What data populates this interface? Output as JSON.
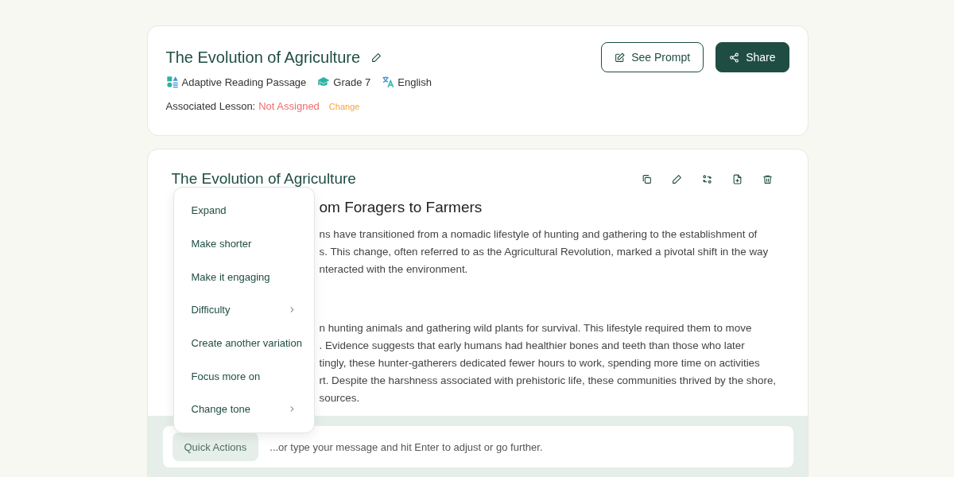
{
  "header": {
    "title": "The Evolution of Agriculture",
    "tags": [
      {
        "kind": "type",
        "label": "Adaptive Reading Passage"
      },
      {
        "kind": "grade",
        "label": "Grade 7"
      },
      {
        "kind": "language",
        "label": "English"
      }
    ],
    "lesson": {
      "label": "Associated Lesson:",
      "value": "Not Assigned",
      "action": "Change"
    },
    "buttons": [
      {
        "kind": "outline",
        "label": "See Prompt"
      },
      {
        "kind": "primary",
        "label": "Share"
      }
    ]
  },
  "document": {
    "title": "The Evolution of Agriculture",
    "blocks": [
      {
        "kind": "heading",
        "lines": [
          "om Foragers to Farmers"
        ]
      },
      {
        "kind": "paragraph",
        "lines": [
          "ns have transitioned from a nomadic lifestyle of hunting and gathering to the establishment of",
          "s. This change, often referred to as the Agricultural Revolution, marked a pivotal shift in the way",
          "nteracted with the environment."
        ]
      },
      {
        "kind": "paragraph",
        "lines": [
          "n hunting animals and gathering wild plants for survival. This lifestyle required them to move",
          ". Evidence suggests that early humans had healthier bones and teeth than those who later",
          "tingly, these hunter-gatherers dedicated fewer hours to work, spending more time on activities",
          "rt. Despite the harshness associated with prehistoric life, these communities thrived by the shore,",
          "sources."
        ]
      }
    ]
  },
  "menu": {
    "items": [
      {
        "label": "Expand",
        "submenu": false
      },
      {
        "label": "Make shorter",
        "submenu": false
      },
      {
        "label": "Make it engaging",
        "submenu": false
      },
      {
        "label": "Difficulty",
        "submenu": true
      },
      {
        "label": "Create another variation",
        "submenu": false
      },
      {
        "label": "Focus more on",
        "submenu": false
      },
      {
        "label": "Change tone",
        "submenu": true
      }
    ]
  },
  "composer": {
    "quick_actions": "Quick Actions",
    "placeholder": "...or type your message and hit Enter to adjust or go further."
  }
}
